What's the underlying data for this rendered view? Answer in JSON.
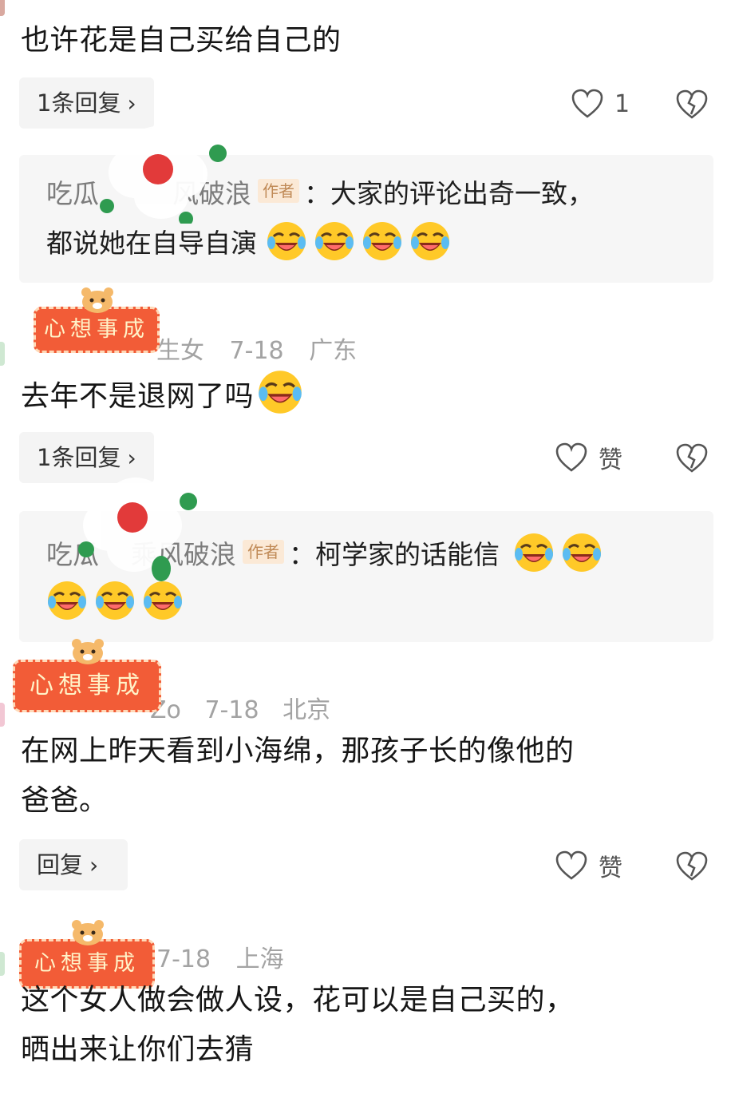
{
  "comments": [
    {
      "text": "也许花是自己买给自己的",
      "reply_label": "1条回复",
      "like_count": "1"
    },
    {
      "meta_date": "7-18",
      "meta_location": "广东",
      "meta_name_fragment": "生女",
      "text": "去年不是退网了吗",
      "reply_label": "1条回复",
      "like_label": "赞"
    },
    {
      "meta_date": "7-18",
      "meta_location": "北京",
      "meta_name_fragment": "Zo",
      "text_line1": "在网上昨天看到小海绵，那孩子长的像他的",
      "text_line2": "爸爸。",
      "reply_label": "回复",
      "like_label": "赞"
    },
    {
      "meta_date": "7-18",
      "meta_location": "上海",
      "text_line1": "这个女人做会做人设，花可以是自己买的，",
      "text_line2": "晒出来让你们去猜"
    }
  ],
  "author_replies": [
    {
      "name_start": "吃瓜",
      "name_end": "风破浪",
      "tag": "作者",
      "line1": "：大家的评论出奇一致，",
      "line2": "都说她在自导自演",
      "emoji": "laughing-crying-emoji"
    },
    {
      "name_start": "吃瓜",
      "name_end": "乘风破浪",
      "tag": "作者",
      "line1": "：柯学家的话能信",
      "emoji": "laughing-crying-emoji"
    }
  ],
  "badge_text": "心想事成",
  "colors": {
    "badge_bg": "#f25c37",
    "author_tag_bg": "#fbe9d6",
    "author_tag_text": "#c08a57",
    "meta_gray": "#a3a3a3",
    "emoji_yellow": "#ffc928"
  }
}
